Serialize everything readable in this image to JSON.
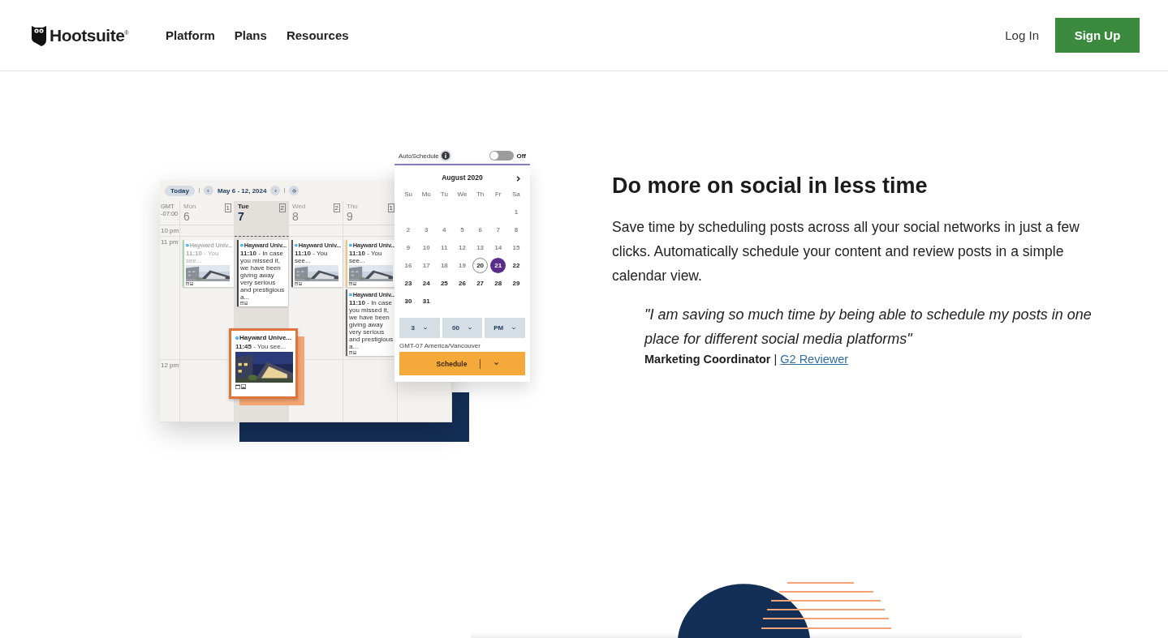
{
  "header": {
    "logo": "Hootsuite$^{®}$",
    "nav": [
      {
        "label": "Platform"
      },
      {
        "label": "Plans"
      },
      {
        "label": "Resources"
      }
    ],
    "login": "Log In",
    "signup": "Sign Up"
  },
  "illustration": {
    "calendar": {
      "today_button": "Today",
      "range": "May 6 - 12, 2024",
      "timezone": "GMT -07:00",
      "times": [
        "10 pm",
        "11 pm",
        "12 pm"
      ],
      "days": [
        {
          "name": "Mon",
          "number": "6",
          "count": "1",
          "selected": false,
          "posts": [
            {
              "title": "Hayward Univ...",
              "text": "**11:10** - You see...",
              "color": "#a8d5b0",
              "faded": true,
              "has_image": true
            }
          ]
        },
        {
          "name": "Tue",
          "number": "7",
          "count": "2",
          "selected": true,
          "posts": [
            {
              "title": "Hayward Univ...",
              "text": "**11:10** - In case you missed it, we have been giving away very serious and prestigious a...",
              "color": "#444444",
              "faded": false,
              "has_image": false
            }
          ]
        },
        {
          "name": "Wed",
          "number": "8",
          "count": "2",
          "selected": false,
          "posts": [
            {
              "title": "Hayward Univ...",
              "text": "**11:10** - You see...",
              "color": "#555555",
              "faded": false,
              "has_image": true
            }
          ]
        },
        {
          "name": "Thu",
          "number": "9",
          "count": "1",
          "selected": false,
          "posts": [
            {
              "title": "Hayward Univ...",
              "text": "**11:10** - You see...",
              "color": "#f0c77a",
              "faded": false,
              "has_image": true
            },
            {
              "title": "Hayward Univ...",
              "text": "**11:10** - In case you missed it, we have been giving away very serious and prestigious a...",
              "color": "#666666",
              "faded": false,
              "has_image": false
            }
          ]
        }
      ],
      "dragged_post": {
        "title": "Hayward Unive...",
        "text": "**11:45** - You see..."
      }
    },
    "picker": {
      "autoschedule": {
        "label": "AutoSchedule",
        "on": false,
        "state_label": "Off"
      },
      "month": "August 2020",
      "weekdays": [
        "Su",
        "Mo",
        "Tu",
        "We",
        "Th",
        "Fr",
        "Sa"
      ],
      "weeks": [
        [
          {
            "kind": "blank"
          },
          {
            "kind": "blank"
          },
          {
            "kind": "blank"
          },
          {
            "kind": "blank"
          },
          {
            "kind": "blank"
          },
          {
            "kind": "blank"
          },
          {
            "kind": "day",
            "label": "1",
            "disabled": true,
            "today": false,
            "selected": false
          }
        ],
        [
          {
            "kind": "day",
            "label": "2",
            "disabled": true,
            "today": false,
            "selected": false
          },
          {
            "kind": "day",
            "label": "3",
            "disabled": true,
            "today": false,
            "selected": false
          },
          {
            "kind": "day",
            "label": "4",
            "disabled": true,
            "today": false,
            "selected": false
          },
          {
            "kind": "day",
            "label": "5",
            "disabled": true,
            "today": false,
            "selected": false
          },
          {
            "kind": "day",
            "label": "6",
            "disabled": true,
            "today": false,
            "selected": false
          },
          {
            "kind": "day",
            "label": "7",
            "disabled": true,
            "today": false,
            "selected": false
          },
          {
            "kind": "day",
            "label": "8",
            "disabled": true,
            "today": false,
            "selected": false
          }
        ],
        [
          {
            "kind": "day",
            "label": "9",
            "disabled": true,
            "today": false,
            "selected": false
          },
          {
            "kind": "day",
            "label": "10",
            "disabled": true,
            "today": false,
            "selected": false
          },
          {
            "kind": "day",
            "label": "11",
            "disabled": true,
            "today": false,
            "selected": false
          },
          {
            "kind": "day",
            "label": "12",
            "disabled": true,
            "today": false,
            "selected": false
          },
          {
            "kind": "day",
            "label": "13",
            "disabled": true,
            "today": false,
            "selected": false
          },
          {
            "kind": "day",
            "label": "14",
            "disabled": true,
            "today": false,
            "selected": false
          },
          {
            "kind": "day",
            "label": "15",
            "disabled": true,
            "today": false,
            "selected": false
          }
        ],
        [
          {
            "kind": "day",
            "label": "16",
            "disabled": true,
            "today": false,
            "selected": false
          },
          {
            "kind": "day",
            "label": "17",
            "disabled": true,
            "today": false,
            "selected": false
          },
          {
            "kind": "day",
            "label": "18",
            "disabled": true,
            "today": false,
            "selected": false
          },
          {
            "kind": "day",
            "label": "19",
            "disabled": true,
            "today": false,
            "selected": false
          },
          {
            "kind": "day",
            "label": "20",
            "disabled": false,
            "today": true,
            "selected": false
          },
          {
            "kind": "day",
            "label": "21",
            "disabled": false,
            "today": false,
            "selected": true
          },
          {
            "kind": "day",
            "label": "22",
            "disabled": false,
            "today": false,
            "selected": false
          }
        ],
        [
          {
            "kind": "day",
            "label": "23",
            "disabled": false,
            "today": false,
            "selected": false
          },
          {
            "kind": "day",
            "label": "24",
            "disabled": false,
            "today": false,
            "selected": false
          },
          {
            "kind": "day",
            "label": "25",
            "disabled": false,
            "today": false,
            "selected": false
          },
          {
            "kind": "day",
            "label": "26",
            "disabled": false,
            "today": false,
            "selected": false
          },
          {
            "kind": "day",
            "label": "27",
            "disabled": false,
            "today": false,
            "selected": false
          },
          {
            "kind": "day",
            "label": "28",
            "disabled": false,
            "today": false,
            "selected": false
          },
          {
            "kind": "day",
            "label": "29",
            "disabled": false,
            "today": false,
            "selected": false
          }
        ],
        [
          {
            "kind": "day",
            "label": "30",
            "disabled": false,
            "today": false,
            "selected": false
          },
          {
            "kind": "day",
            "label": "31",
            "disabled": false,
            "today": false,
            "selected": false
          }
        ]
      ],
      "time_selects": [
        {
          "value": "3"
        },
        {
          "value": "00"
        },
        {
          "value": "PM"
        }
      ],
      "timezone": "GMT-07 America/Vancouver",
      "schedule_button": "Schedule"
    }
  },
  "content": {
    "heading": "Do more on social in less time",
    "paragraph": "Save time by scheduling posts across all your social networks in just a few clicks. Automatically schedule your content and review posts in a simple calendar view.",
    "quote": "\"I am saving so much time by being able to schedule my posts in one place for different social media platforms\"",
    "author": "Marketing Coordinator",
    "separator": "|",
    "source": "G2 Reviewer"
  }
}
